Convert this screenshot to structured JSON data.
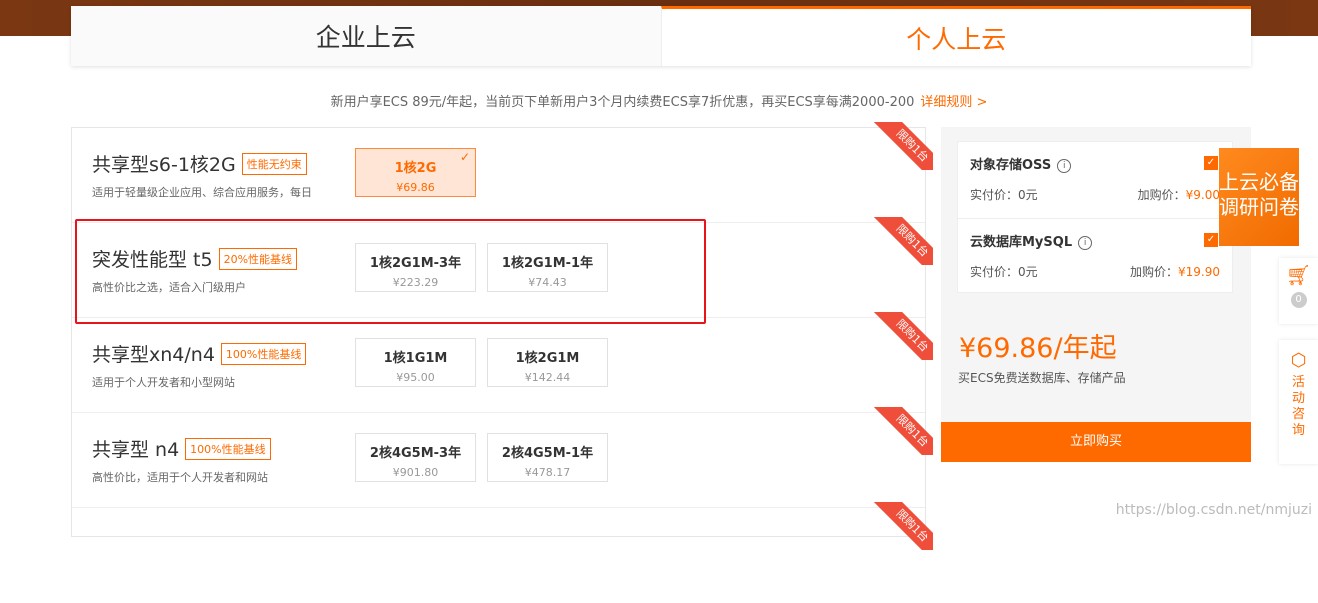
{
  "tabs": [
    {
      "label": "企业上云",
      "active": false
    },
    {
      "label": "个人上云",
      "active": true
    }
  ],
  "promo": {
    "text": "新用户享ECS 89元/年起，当前页下单新用户3个月内续费ECS享7折优惠，再买ECS享每满2000-200",
    "link": "详细规则 >"
  },
  "ribbon_text": "限购1台",
  "products": [
    {
      "name": "共享型s6-1核2G",
      "badge": "性能无约束",
      "desc": "适用于轻量级企业应用、综合应用服务，每日",
      "options": [
        {
          "label": "1核2G",
          "price": "¥69.86",
          "selected": true
        }
      ]
    },
    {
      "name": "突发性能型 t5",
      "badge": "20%性能基线",
      "desc": "高性价比之选，适合入门级用户",
      "options": [
        {
          "label": "1核2G1M-3年",
          "price": "¥223.29",
          "selected": false
        },
        {
          "label": "1核2G1M-1年",
          "price": "¥74.43",
          "selected": false
        }
      ]
    },
    {
      "name": "共享型xn4/n4",
      "badge": "100%性能基线",
      "desc": "适用于个人开发者和小型网站",
      "options": [
        {
          "label": "1核1G1M",
          "price": "¥95.00",
          "selected": false
        },
        {
          "label": "1核2G1M",
          "price": "¥142.44",
          "selected": false
        }
      ]
    },
    {
      "name": "共享型 n4",
      "badge": "100%性能基线",
      "desc": "高性价比，适用于个人开发者和网站",
      "options": [
        {
          "label": "2核4G5M-3年",
          "price": "¥901.80",
          "selected": false
        },
        {
          "label": "2核4G5M-1年",
          "price": "¥478.17",
          "selected": false
        }
      ]
    }
  ],
  "addons": [
    {
      "name": "对象存储OSS",
      "paid_label": "实付价：0元",
      "add_label": "加购价：",
      "add_price": "¥9.00"
    },
    {
      "name": "云数据库MySQL",
      "paid_label": "实付价：0元",
      "add_label": "加购价：",
      "add_price": "¥19.90"
    }
  ],
  "summary": {
    "price": "¥69.86/年起",
    "note": "买ECS免费送数据库、存储产品",
    "buy": "立即购买"
  },
  "floating": {
    "survey": "上云必备调研问卷",
    "cart_count": "0",
    "consult": "活动咨询"
  },
  "watermark": "https://blog.csdn.net/nmjuzi",
  "colors": {
    "accent": "#ff6a00",
    "ribbon": "#ef4e3a",
    "highlight": "#e8141a"
  }
}
